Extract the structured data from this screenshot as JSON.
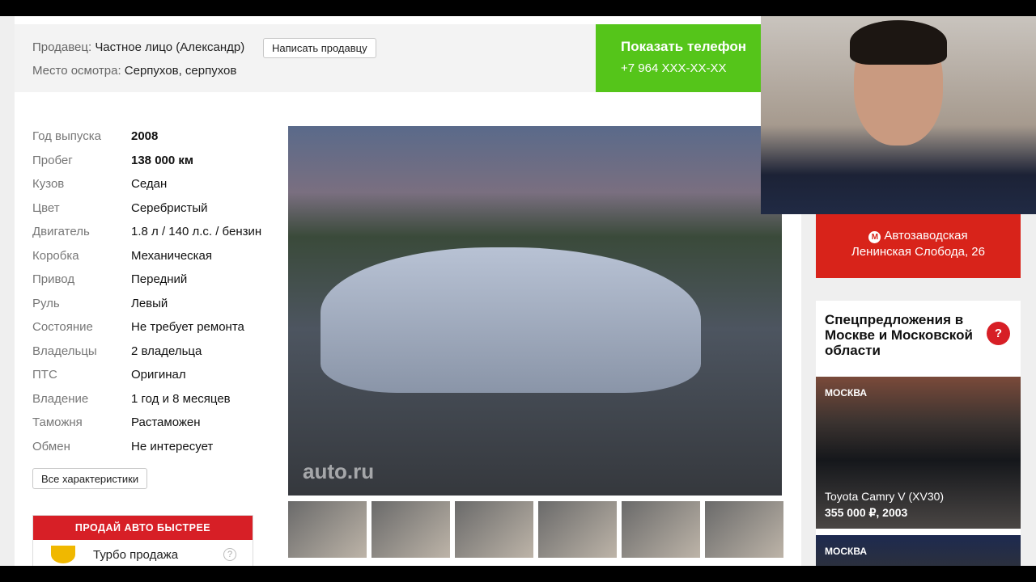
{
  "seller": {
    "label": "Продавец:",
    "value": "Частное лицо (Александр)",
    "message_button": "Написать продавцу",
    "place_label": "Место осмотра:",
    "place_value": "Серпухов, серпухов"
  },
  "phone": {
    "title": "Показать телефон",
    "number": "+7 964 XXX-XX-XX"
  },
  "specs": [
    {
      "k": "Год выпуска",
      "v": "2008",
      "bold": true
    },
    {
      "k": "Пробег",
      "v": "138 000 км",
      "bold": true
    },
    {
      "k": "Кузов",
      "v": "Седан"
    },
    {
      "k": "Цвет",
      "v": "Серебристый"
    },
    {
      "k": "Двигатель",
      "v": "1.8 л / 140 л.с. / бензин"
    },
    {
      "k": "Коробка",
      "v": "Механическая"
    },
    {
      "k": "Привод",
      "v": "Передний"
    },
    {
      "k": "Руль",
      "v": "Левый"
    },
    {
      "k": "Состояние",
      "v": "Не требует ремонта"
    },
    {
      "k": "Владельцы",
      "v": "2 владельца"
    },
    {
      "k": "ПТС",
      "v": "Оригинал"
    },
    {
      "k": "Владение",
      "v": "1 год и 8 месяцев"
    },
    {
      "k": "Таможня",
      "v": "Растаможен"
    },
    {
      "k": "Обмен",
      "v": "Не интересует"
    }
  ],
  "all_specs_button": "Все характеристики",
  "photo": {
    "watermark": "auto.ru",
    "thumbnail_count": 6
  },
  "promo": {
    "header": "ПРОДАЙ АВТО БЫСТРЕЕ",
    "item": "Турбо продажа",
    "help": "?"
  },
  "metro": {
    "icon": "М",
    "station": "Автозаводская",
    "address": "Ленинская Слобода, 26"
  },
  "offers": {
    "title": "Спецпредложения в Москве и Московской области",
    "help": "?",
    "cards": [
      {
        "city": "МОСКВА",
        "name": "Toyota Camry V (XV30)",
        "price": "355 000 ₽, 2003"
      },
      {
        "city": "МОСКВА"
      }
    ]
  }
}
